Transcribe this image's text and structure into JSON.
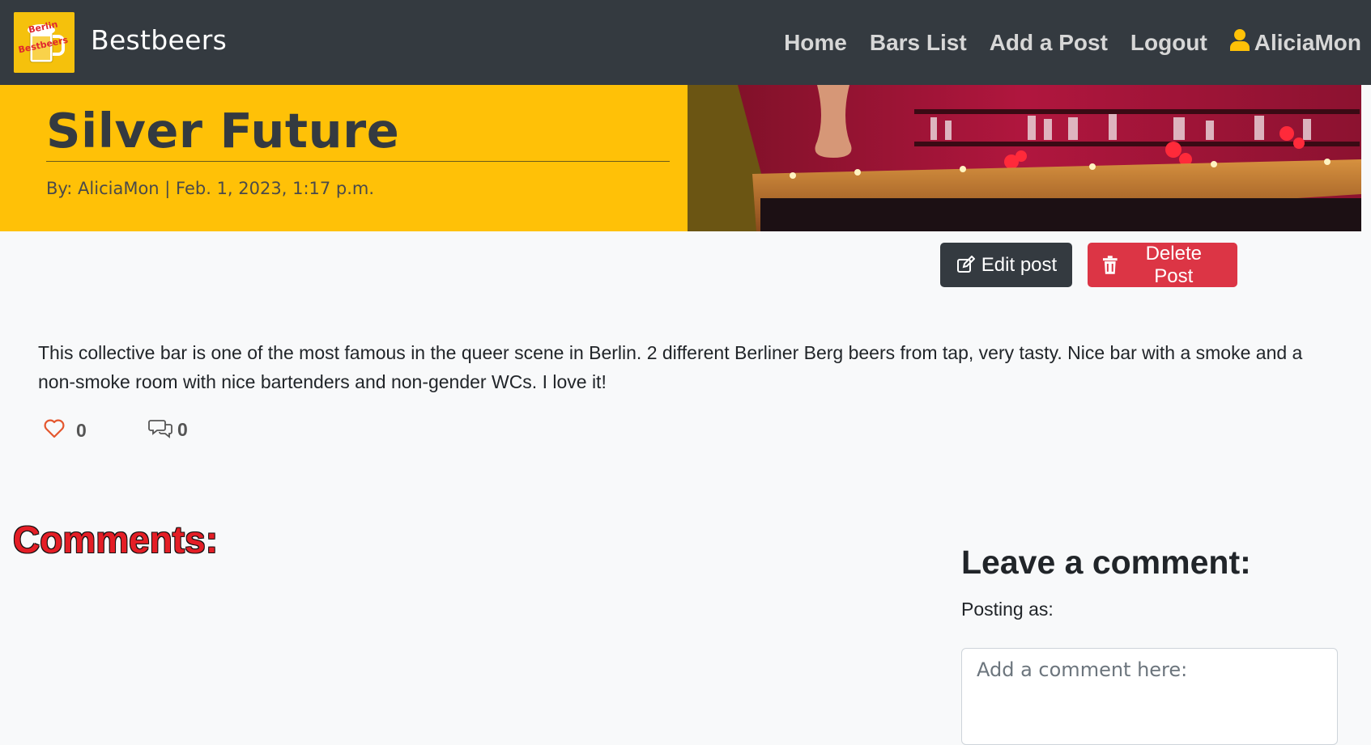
{
  "brand": {
    "name": "Bestbeers",
    "logo_text_top": "Berlin",
    "logo_text_bottom": "Bestbeers"
  },
  "nav": {
    "items": [
      {
        "label": "Home"
      },
      {
        "label": "Bars List"
      },
      {
        "label": "Add a Post"
      },
      {
        "label": "Logout"
      }
    ],
    "user": "AliciaMon",
    "user_icon": "user-icon"
  },
  "post": {
    "title": "Silver Future",
    "meta": "By: AliciaMon | Feb. 1, 2023, 1:17 p.m.",
    "body": "This collective bar is one of the most famous in the queer scene in Berlin. 2 different Berliner Berg beers from tap, very tasty. Nice bar with a smoke and a non-smoke room with nice bartenders and non-gender WCs. I love it!",
    "likes": "0",
    "comment_count": "0"
  },
  "actions": {
    "edit_label": "Edit post",
    "delete_label": "Delete Post"
  },
  "comments": {
    "heading": "Comments:"
  },
  "comment_form": {
    "heading": "Leave a comment:",
    "posting_as": "Posting as:",
    "placeholder": "Add a comment here:"
  },
  "colors": {
    "navbar": "#343a40",
    "accent_yellow": "#ffc107",
    "danger": "#dc3545",
    "comments_heading": "#e41e26"
  }
}
